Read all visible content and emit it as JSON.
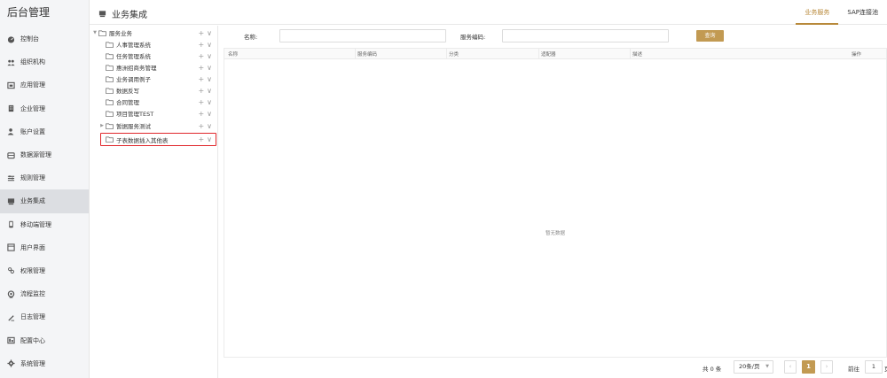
{
  "app": {
    "brand": "后台管理"
  },
  "sidebar": {
    "items": [
      {
        "label": "控制台",
        "icon": "dashboard-icon"
      },
      {
        "label": "组织机构",
        "icon": "org-icon"
      },
      {
        "label": "应用管理",
        "icon": "app-icon"
      },
      {
        "label": "企业管理",
        "icon": "building-icon"
      },
      {
        "label": "账户设置",
        "icon": "user-icon"
      },
      {
        "label": "数据源管理",
        "icon": "database-icon"
      },
      {
        "label": "规则管理",
        "icon": "rules-icon"
      },
      {
        "label": "业务集成",
        "icon": "integration-icon",
        "active": true
      },
      {
        "label": "移动端管理",
        "icon": "mobile-icon"
      },
      {
        "label": "用户界面",
        "icon": "ui-icon"
      },
      {
        "label": "权限管理",
        "icon": "permission-icon"
      },
      {
        "label": "流程监控",
        "icon": "monitor-icon"
      },
      {
        "label": "日志管理",
        "icon": "log-icon"
      },
      {
        "label": "配置中心",
        "icon": "config-icon"
      },
      {
        "label": "系统管理",
        "icon": "gear-icon"
      }
    ]
  },
  "header": {
    "title": "业务集成",
    "tabs": [
      {
        "label": "业务服务",
        "active": true
      },
      {
        "label": "SAP连接池"
      }
    ]
  },
  "tree": {
    "root": "服务业务",
    "children": [
      "人事管理系统",
      "任务管理系统",
      "惠洲招商务管理",
      "业务调用例子",
      "数据反写",
      "合同管理",
      "项目管理TEST",
      "暂据服务测试",
      "子表数据插入其他表"
    ],
    "actions": {
      "add": "+",
      "expand": "∨"
    }
  },
  "search": {
    "name_label": "名称:",
    "code_label": "服务编码:",
    "query_button": "查询"
  },
  "table": {
    "columns": [
      "名称",
      "服务编码",
      "分类",
      "适配器",
      "描述",
      "操作"
    ],
    "empty_text": "暂无数据"
  },
  "pager": {
    "total": "共 0 条",
    "page_size": "20条/页",
    "current_page": "1",
    "goto_label": "前往",
    "goto_value": "1",
    "page_unit": "页"
  }
}
